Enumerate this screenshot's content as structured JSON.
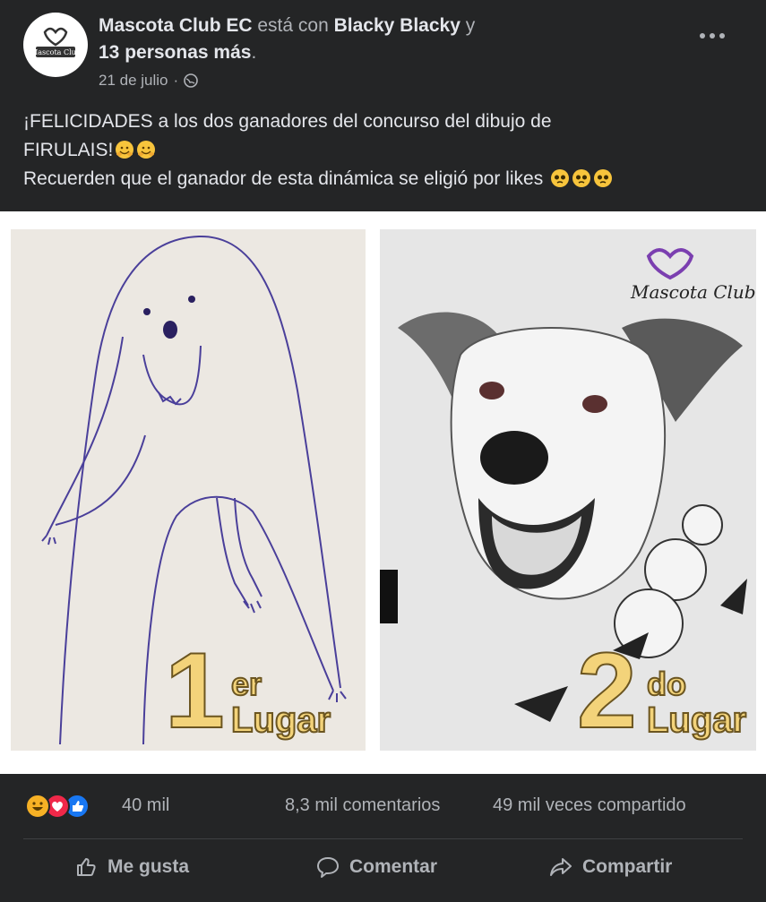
{
  "post": {
    "author": "Mascota Club EC",
    "with_text": "está con",
    "tagged": "Blacky Blacky",
    "and_text": "y",
    "others": "13 personas más",
    "period": ".",
    "date": "21 de julio",
    "separator": "·",
    "avatar_text": "Mascota Club",
    "line1": "¡FELICIDADES a los dos ganadores del concurso del dibujo de",
    "line2": "FIRULAIS!",
    "line3": "Recuerden que el ganador de esta dinámica se eligió por likes"
  },
  "photo": {
    "first_num": "1",
    "first_sup": "er",
    "first_word": "Lugar",
    "second_num": "2",
    "second_sup": "do",
    "second_word": "Lugar",
    "brand": "Mascota Club"
  },
  "stats": {
    "reactions": "40 mil",
    "comments": "8,3 mil comentarios",
    "shares": "49 mil veces compartido"
  },
  "actions": {
    "like": "Me gusta",
    "comment": "Comentar",
    "share": "Compartir"
  },
  "colors": {
    "background": "#242526",
    "text": "#e4e6eb",
    "muted": "#b0b3b8",
    "like_blue": "#1877f2",
    "love_red": "#f02849",
    "haha_yellow": "#f7b125",
    "brand_purple": "#7b3fb0"
  }
}
